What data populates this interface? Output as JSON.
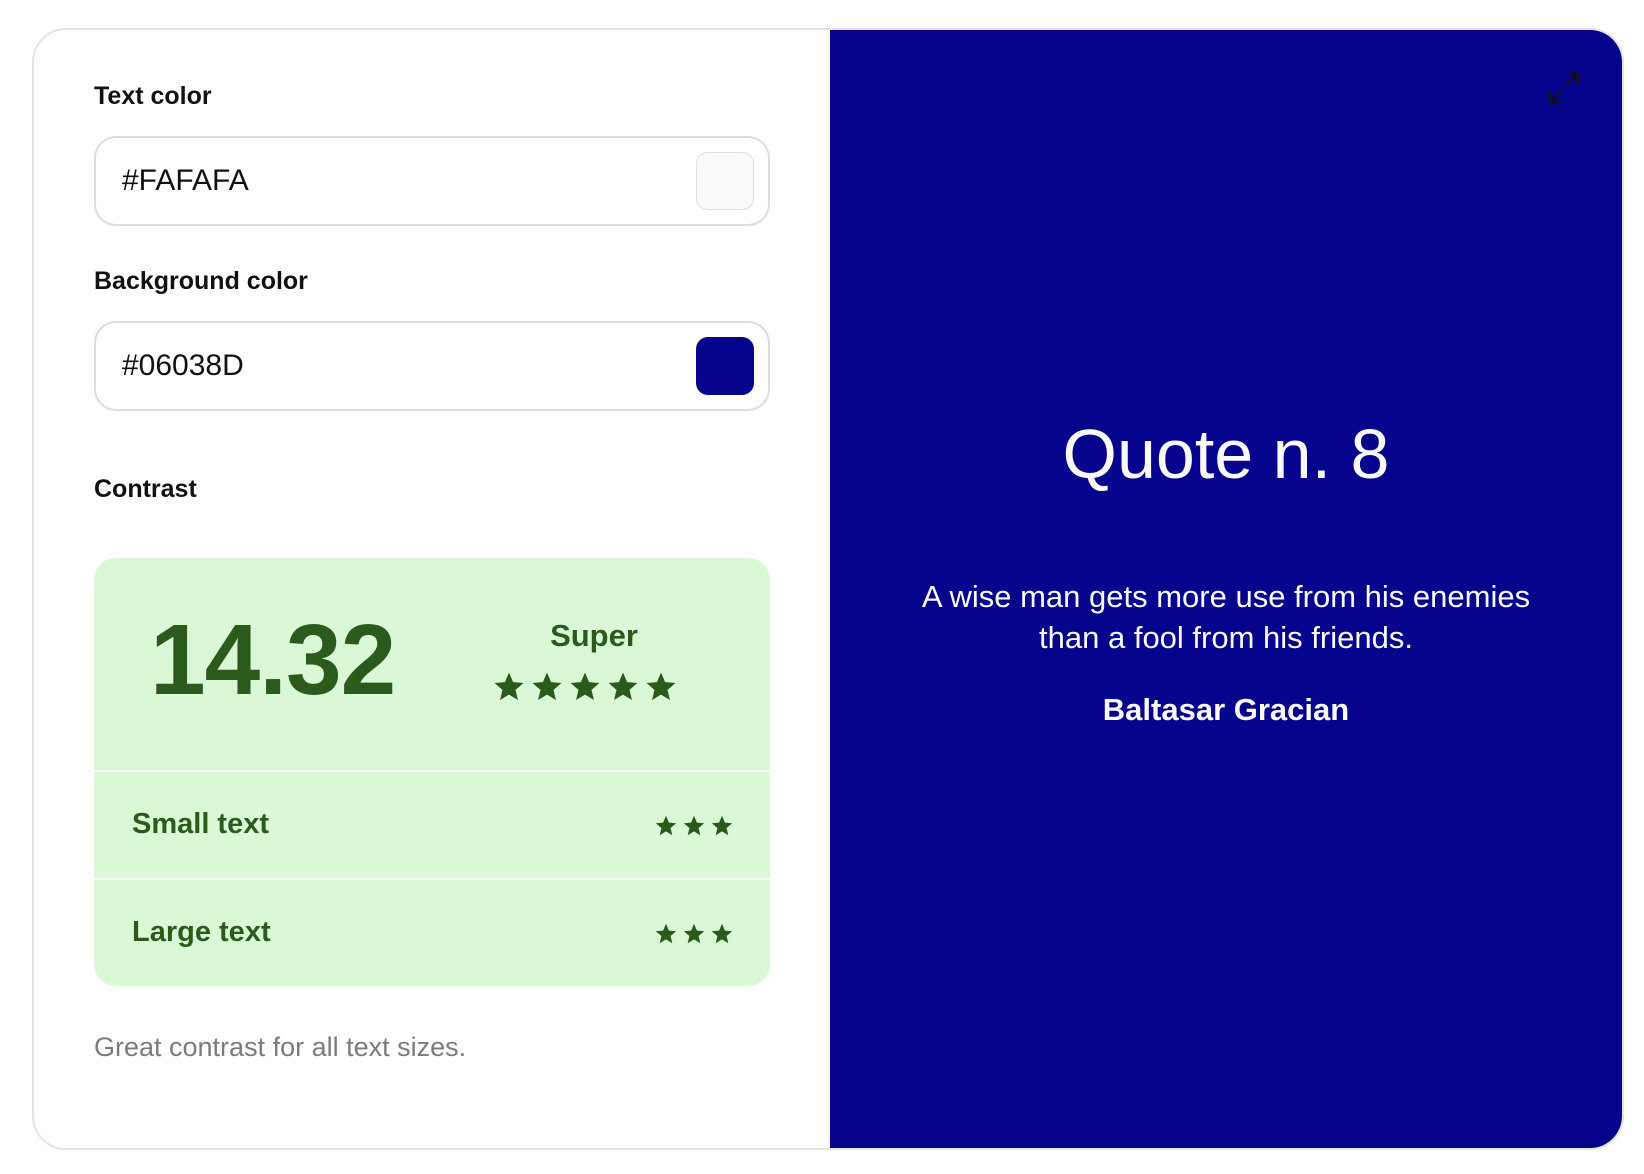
{
  "colors": {
    "text_color_label": "Text color",
    "text_color_value": "#FAFAFA",
    "background_color_label": "Background color",
    "background_color_value": "#06038D",
    "accent_green_dark": "#2A5B1C",
    "accent_green_light": "#DAF8D6"
  },
  "contrast": {
    "label": "Contrast",
    "ratio": "14.32",
    "rating": "Super",
    "rating_stars": 5,
    "small_text": {
      "label": "Small text",
      "stars": 3
    },
    "large_text": {
      "label": "Large text",
      "stars": 3
    },
    "note": "Great contrast for all text sizes."
  },
  "preview": {
    "title": "Quote n. 8",
    "text": "A wise man gets more use from his enemies than a fool from his friends.",
    "author": "Baltasar Gracian",
    "expand_icon": "expand-icon"
  }
}
